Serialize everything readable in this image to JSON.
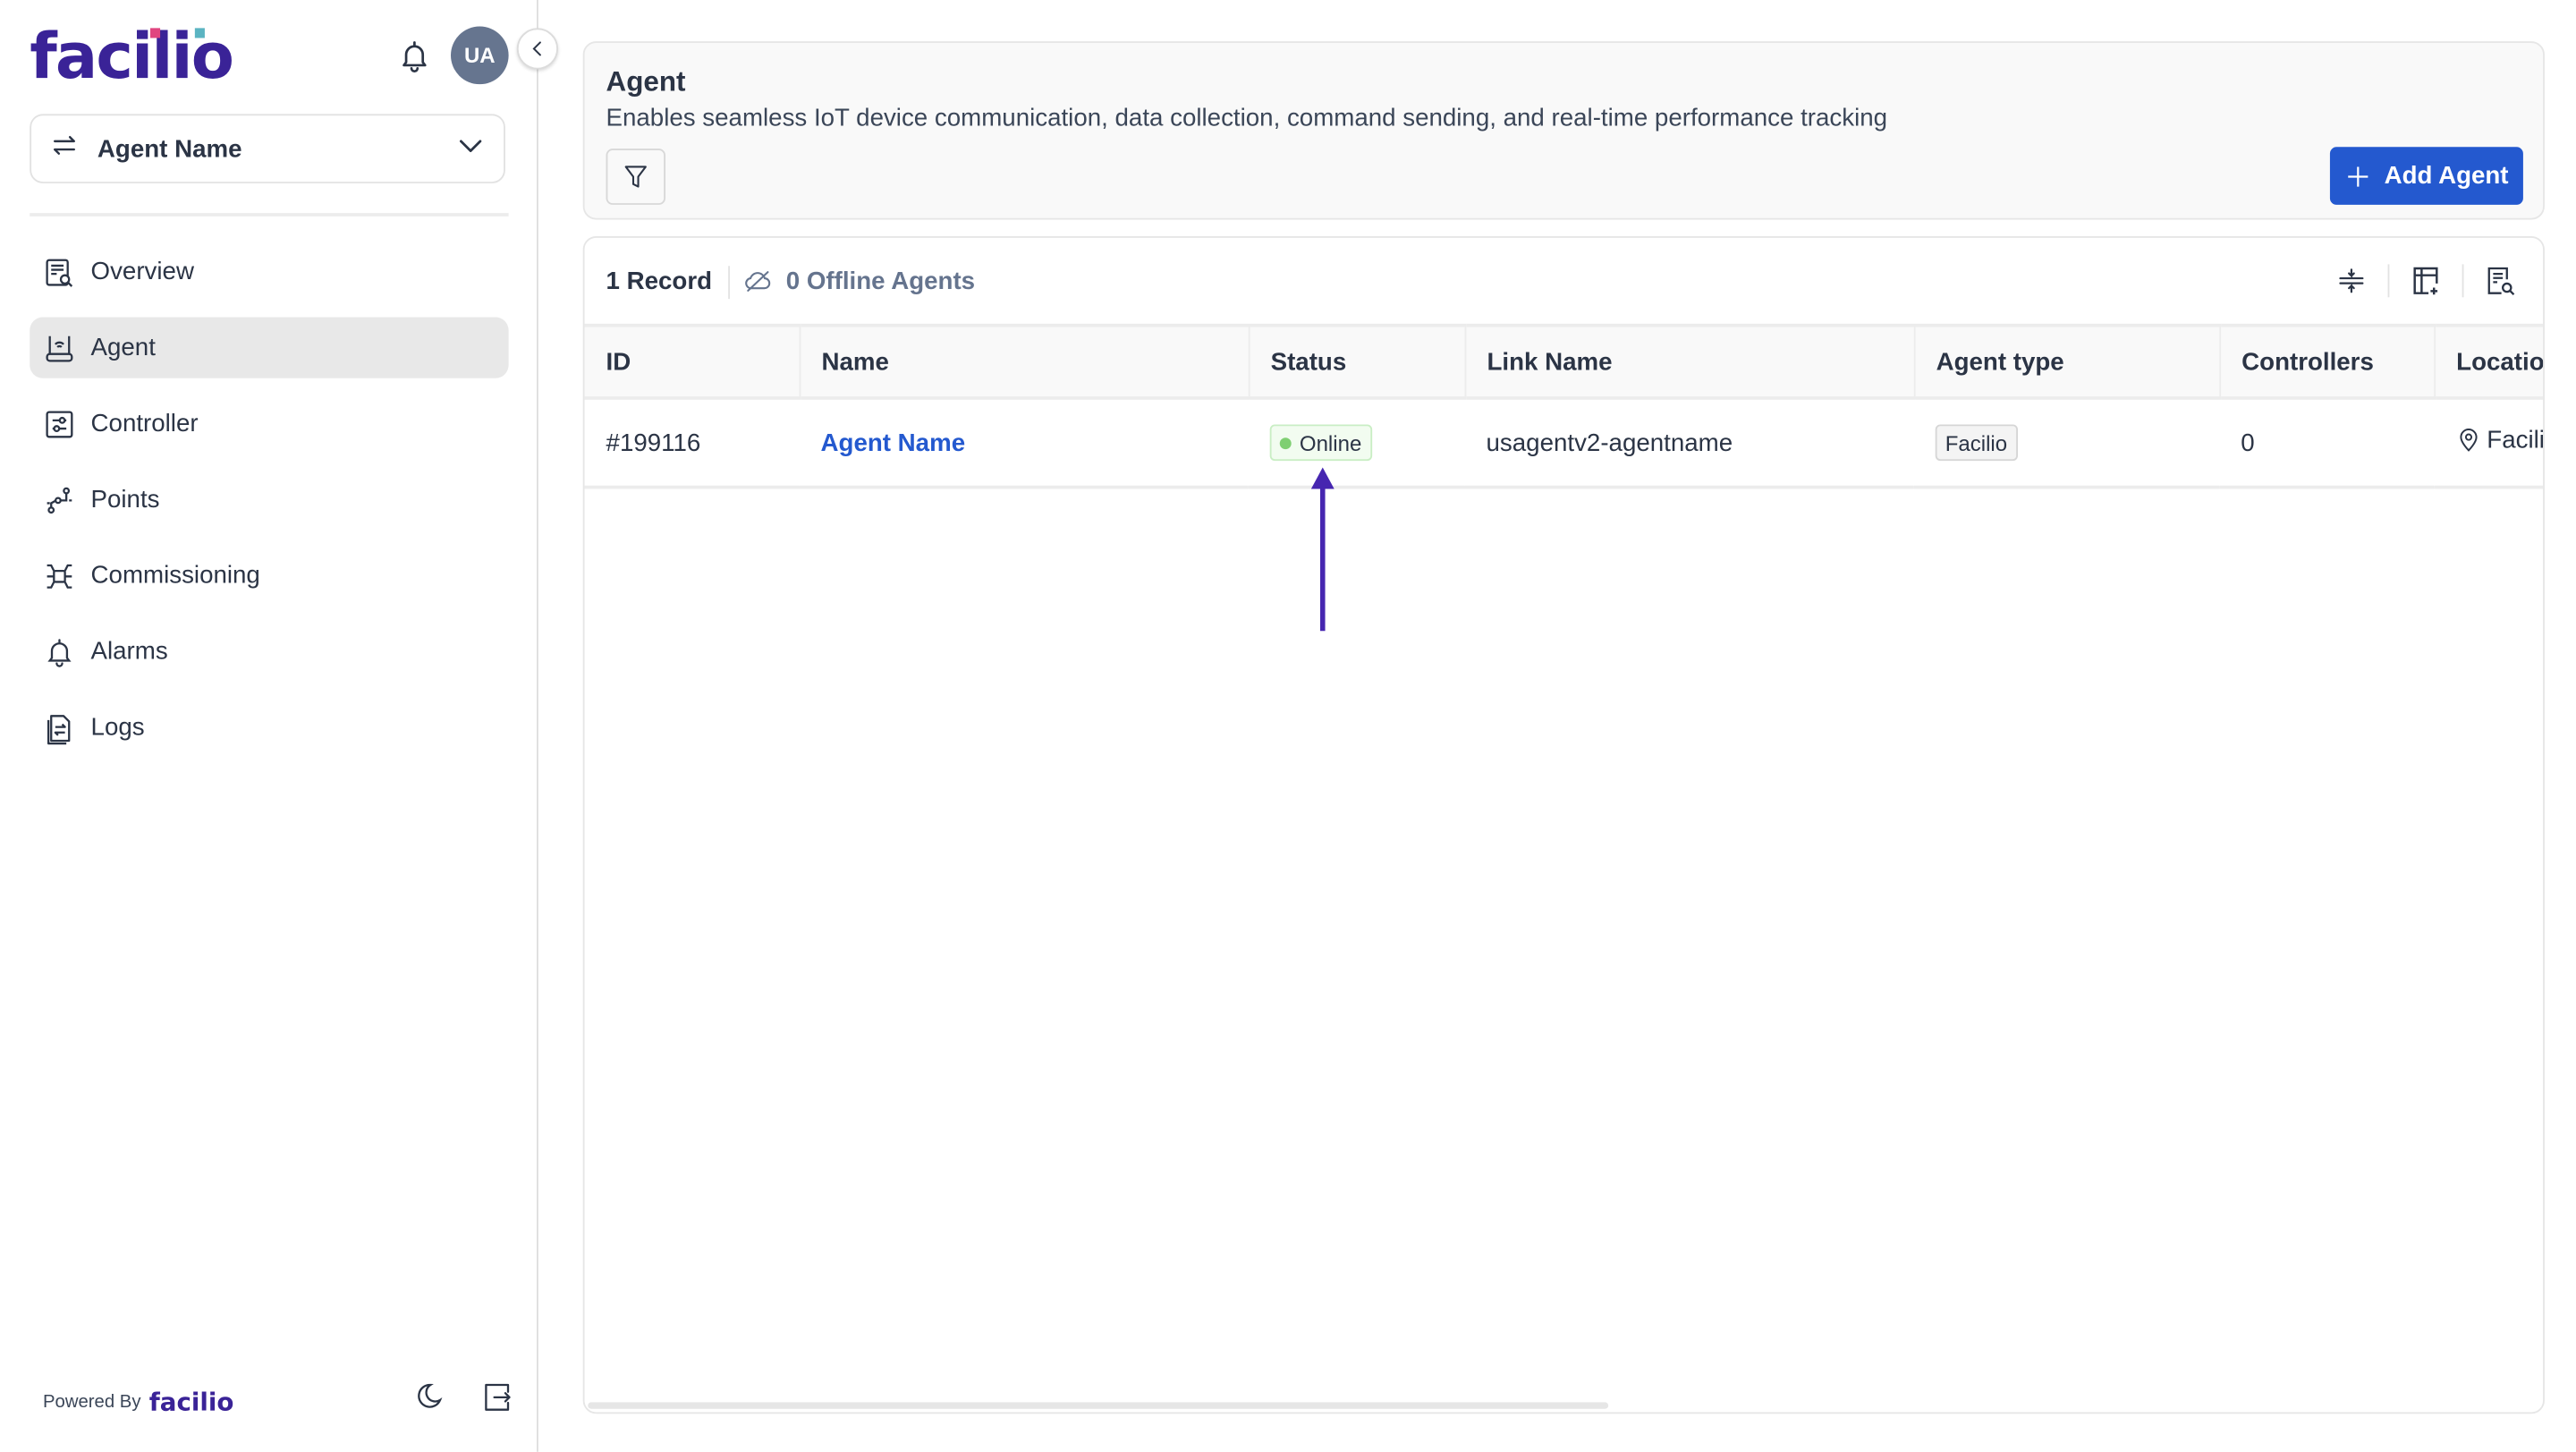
{
  "brand": {
    "logo_text": "facilio",
    "logo_color": "#3a2397",
    "accent_dot_1": "#e0457f",
    "accent_dot_2": "#5bb4c2"
  },
  "header_icons": {
    "notification": "bell-icon",
    "avatar_initials": "UA",
    "collapse": "chevron-left-icon"
  },
  "agent_selector": {
    "icon": "switch-arrows-icon",
    "label": "Agent Name",
    "chevron": "chevron-down-icon"
  },
  "sidebar": {
    "items": [
      {
        "label": "Overview",
        "icon": "overview-icon",
        "active": false
      },
      {
        "label": "Agent",
        "icon": "router-icon",
        "active": true
      },
      {
        "label": "Controller",
        "icon": "controller-icon",
        "active": false
      },
      {
        "label": "Points",
        "icon": "points-icon",
        "active": false
      },
      {
        "label": "Commissioning",
        "icon": "commissioning-icon",
        "active": false
      },
      {
        "label": "Alarms",
        "icon": "bell-icon",
        "active": false
      },
      {
        "label": "Logs",
        "icon": "logs-icon",
        "active": false
      }
    ]
  },
  "footer": {
    "powered_by": "Powered By",
    "logo_text": "facilio",
    "theme_icon": "moon-icon",
    "logout_icon": "logout-icon"
  },
  "page": {
    "title": "Agent",
    "description": "Enables seamless IoT device communication, data collection, command sending, and real-time performance tracking",
    "filter_icon": "filter-icon",
    "add_button": "Add Agent",
    "primary_color": "#2459cf"
  },
  "toolbar": {
    "record_count": "1 Record",
    "offline_agents": "0 Offline Agents",
    "icons": [
      "row-density-icon",
      "add-column-icon",
      "search-report-icon"
    ]
  },
  "table": {
    "columns": [
      "ID",
      "Name",
      "Status",
      "Link Name",
      "Agent type",
      "Controllers",
      "Location"
    ],
    "rows": [
      {
        "id": "#199116",
        "name": "Agent Name",
        "status": "Online",
        "link_name": "usagentv2-agentname",
        "agent_type": "Facilio",
        "controllers": "0",
        "location": "Facilio"
      }
    ]
  },
  "annotation": {
    "type": "arrow",
    "target": "status-badge",
    "color": "#4626b0"
  }
}
